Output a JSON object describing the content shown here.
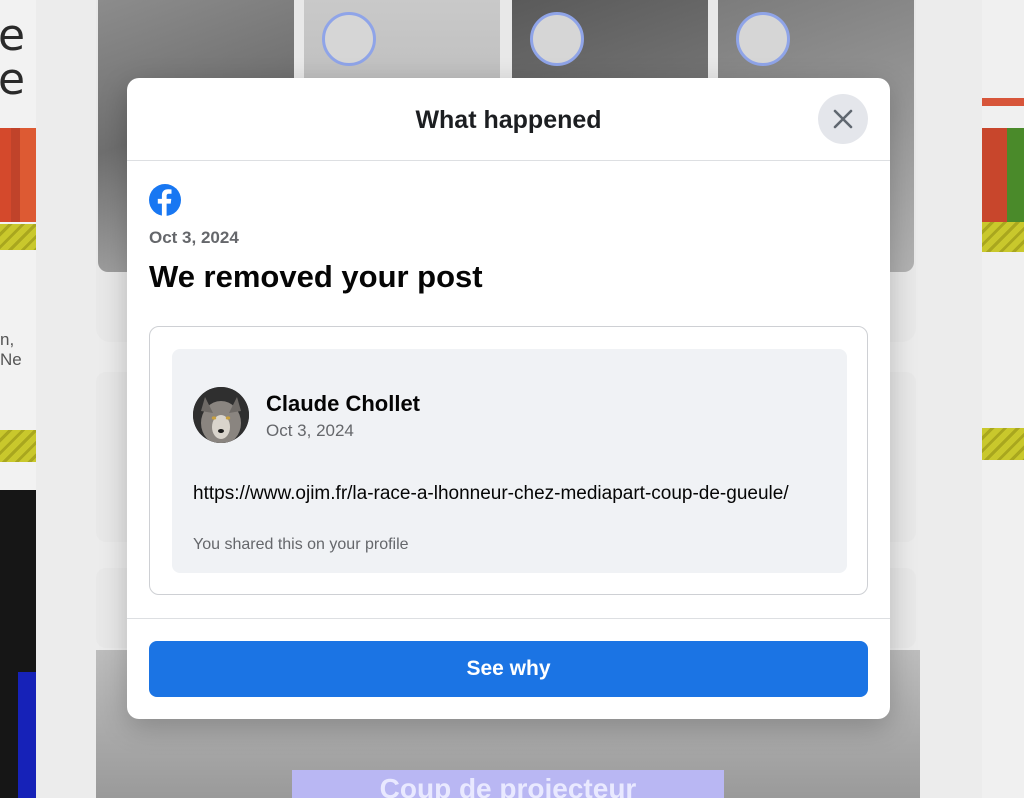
{
  "modal": {
    "title": "What happened",
    "close_icon": "close-icon",
    "brand_icon": "facebook-logo-icon",
    "brand_color": "#1877f2",
    "date": "Oct 3, 2024",
    "headline": "We removed your post",
    "post": {
      "author": "Claude Chollet",
      "date": "Oct 3, 2024",
      "link": "https://www.ojim.fr/la-race-a-lhonneur-chez-mediapart-coup-de-gueule/",
      "shared_note": "You shared this on your profile"
    },
    "primary_button": "See why",
    "primary_color": "#1b74e4"
  },
  "background": {
    "banner_text": "Coup de projecteur",
    "left_text_fragment": "n, Ne",
    "left_big_letters": [
      "e",
      "e"
    ]
  }
}
